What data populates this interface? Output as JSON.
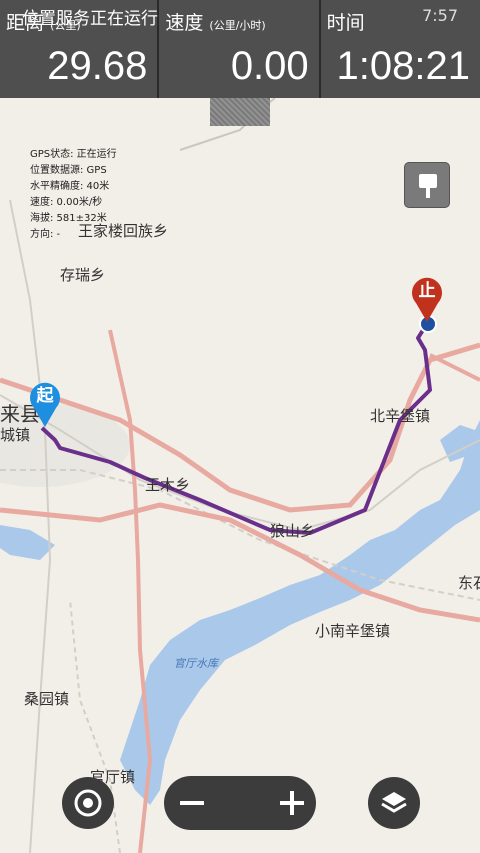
{
  "status": {
    "notification": "位置服务正在运行",
    "clock": "7:57"
  },
  "stats": {
    "distance": {
      "label": "距离",
      "unit": "(公里)",
      "value": "29.68"
    },
    "speed": {
      "label": "速度",
      "unit": "(公里/小时)",
      "value": "0.00"
    },
    "time": {
      "label": "时间",
      "value": "1:08:21"
    }
  },
  "gps_info": [
    "GPS状态: 正在运行",
    "位置数据源: GPS",
    "水平精确度: 40米",
    "速度: 0.00米/秒",
    "海拔: 581±32米",
    "方向: -"
  ],
  "markers": {
    "start": "起",
    "end": "止"
  },
  "places": [
    "王家楼回族乡",
    "存瑞乡",
    "来县",
    "城镇",
    "北辛堡镇",
    "王木乡",
    "狼山乡",
    "东石",
    "小南辛堡镇",
    "官厅水库",
    "桑园镇",
    "官厅镇"
  ],
  "colors": {
    "track": "#6a2f8a",
    "road": "#e8a9a0",
    "water": "#a9c8ea",
    "start": "#1e8fe0",
    "end": "#c0321e",
    "panel": "#484848"
  },
  "controls": {
    "locate_icon": "target-icon",
    "zoom_out_icon": "minus-icon",
    "zoom_in_icon": "plus-icon",
    "layers_icon": "layers-icon",
    "pin_icon": "pin-icon"
  }
}
